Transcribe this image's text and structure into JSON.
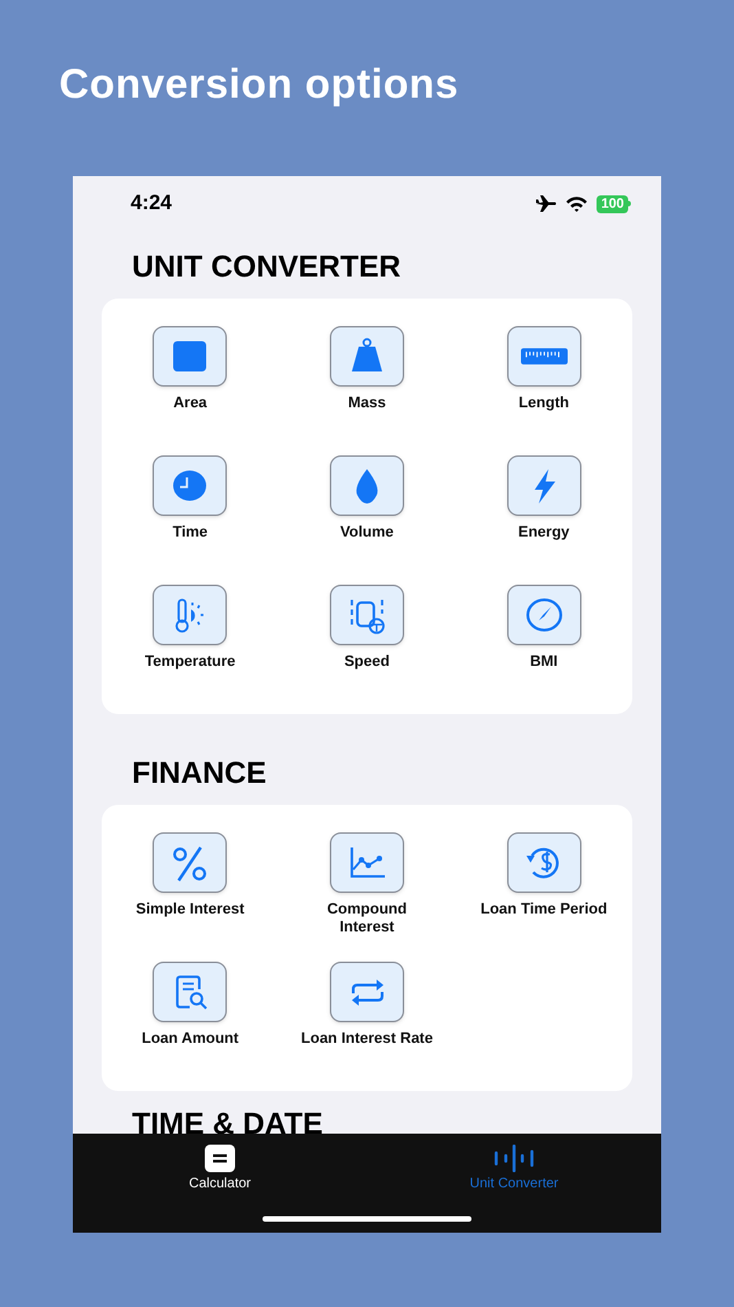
{
  "headline": "Conversion options",
  "status_bar": {
    "time": "4:24",
    "battery": "100"
  },
  "sections": [
    {
      "title": "UNIT CONVERTER",
      "items": [
        {
          "label": "Area"
        },
        {
          "label": "Mass"
        },
        {
          "label": "Length"
        },
        {
          "label": "Time"
        },
        {
          "label": "Volume"
        },
        {
          "label": "Energy"
        },
        {
          "label": "Temperature"
        },
        {
          "label": "Speed"
        },
        {
          "label": "BMI"
        }
      ]
    },
    {
      "title": "FINANCE",
      "items": [
        {
          "label": "Simple Interest"
        },
        {
          "label": "Compound Interest"
        },
        {
          "label": "Loan Time Period"
        },
        {
          "label": "Loan Amount"
        },
        {
          "label": "Loan Interest Rate"
        }
      ]
    },
    {
      "title": "TIME & DATE"
    }
  ],
  "tab_bar": [
    {
      "label": "Calculator",
      "selected": false
    },
    {
      "label": "Unit Converter",
      "selected": true
    }
  ]
}
